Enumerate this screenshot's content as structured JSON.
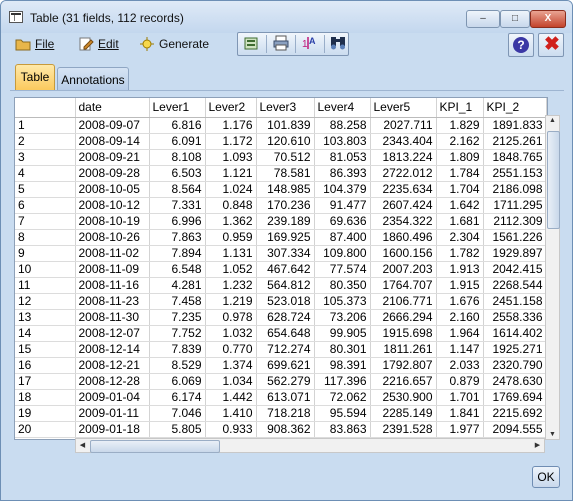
{
  "window": {
    "title": "Table (31 fields, 112 records)"
  },
  "titlebar_buttons": {
    "minimize": "–",
    "maximize": "□",
    "close": "X"
  },
  "menu": {
    "file": {
      "label": "File"
    },
    "edit": {
      "label": "Edit"
    },
    "generate": {
      "label": "Generate"
    }
  },
  "toolbar": {
    "icons": [
      "export-icon",
      "print-icon",
      "sort-icon",
      "find-icon"
    ]
  },
  "help_button": {
    "label": "?"
  },
  "close_button": {
    "label": "✖"
  },
  "tabs": [
    {
      "label": "Table",
      "active": true
    },
    {
      "label": "Annotations",
      "active": false
    }
  ],
  "table": {
    "columns": [
      "",
      "date",
      "Lever1",
      "Lever2",
      "Lever3",
      "Lever4",
      "Lever5",
      "KPI_1",
      "KPI_2"
    ],
    "rows": [
      [
        "1",
        "2008-09-07",
        "6.816",
        "1.176",
        "101.839",
        "88.258",
        "2027.711",
        "1.829",
        "1891.833"
      ],
      [
        "2",
        "2008-09-14",
        "6.091",
        "1.172",
        "120.610",
        "103.803",
        "2343.404",
        "2.162",
        "2125.261"
      ],
      [
        "3",
        "2008-09-21",
        "8.108",
        "1.093",
        "70.512",
        "81.053",
        "1813.224",
        "1.809",
        "1848.765"
      ],
      [
        "4",
        "2008-09-28",
        "6.503",
        "1.121",
        "78.581",
        "86.393",
        "2722.012",
        "1.784",
        "2551.153"
      ],
      [
        "5",
        "2008-10-05",
        "8.564",
        "1.024",
        "148.985",
        "104.379",
        "2235.634",
        "1.704",
        "2186.098"
      ],
      [
        "6",
        "2008-10-12",
        "7.331",
        "0.848",
        "170.236",
        "91.477",
        "2607.424",
        "1.642",
        "1711.295"
      ],
      [
        "7",
        "2008-10-19",
        "6.996",
        "1.362",
        "239.189",
        "69.636",
        "2354.322",
        "1.681",
        "2112.309"
      ],
      [
        "8",
        "2008-10-26",
        "7.863",
        "0.959",
        "169.925",
        "87.400",
        "1860.496",
        "2.304",
        "1561.226"
      ],
      [
        "9",
        "2008-11-02",
        "7.894",
        "1.131",
        "307.334",
        "109.800",
        "1600.156",
        "1.782",
        "1929.897"
      ],
      [
        "10",
        "2008-11-09",
        "6.548",
        "1.052",
        "467.642",
        "77.574",
        "2007.203",
        "1.913",
        "2042.415"
      ],
      [
        "11",
        "2008-11-16",
        "4.281",
        "1.232",
        "564.812",
        "80.350",
        "1764.707",
        "1.915",
        "2268.544"
      ],
      [
        "12",
        "2008-11-23",
        "7.458",
        "1.219",
        "523.018",
        "105.373",
        "2106.771",
        "1.676",
        "2451.158"
      ],
      [
        "13",
        "2008-11-30",
        "7.235",
        "0.978",
        "628.724",
        "73.206",
        "2666.294",
        "2.160",
        "2558.336"
      ],
      [
        "14",
        "2008-12-07",
        "7.752",
        "1.032",
        "654.648",
        "99.905",
        "1915.698",
        "1.964",
        "1614.402"
      ],
      [
        "15",
        "2008-12-14",
        "7.839",
        "0.770",
        "712.274",
        "80.301",
        "1811.261",
        "1.147",
        "1925.271"
      ],
      [
        "16",
        "2008-12-21",
        "8.529",
        "1.374",
        "699.621",
        "98.391",
        "1792.807",
        "2.033",
        "2320.790"
      ],
      [
        "17",
        "2008-12-28",
        "6.069",
        "1.034",
        "562.279",
        "117.396",
        "2216.657",
        "0.879",
        "2478.630"
      ],
      [
        "18",
        "2009-01-04",
        "6.174",
        "1.442",
        "613.071",
        "72.062",
        "2530.900",
        "1.701",
        "1769.694"
      ],
      [
        "19",
        "2009-01-11",
        "7.046",
        "1.410",
        "718.218",
        "95.594",
        "2285.149",
        "1.841",
        "2215.692"
      ],
      [
        "20",
        "2009-01-18",
        "5.805",
        "0.933",
        "908.362",
        "83.863",
        "2391.528",
        "1.977",
        "2094.555"
      ]
    ]
  },
  "ok_button": {
    "label": "OK"
  }
}
